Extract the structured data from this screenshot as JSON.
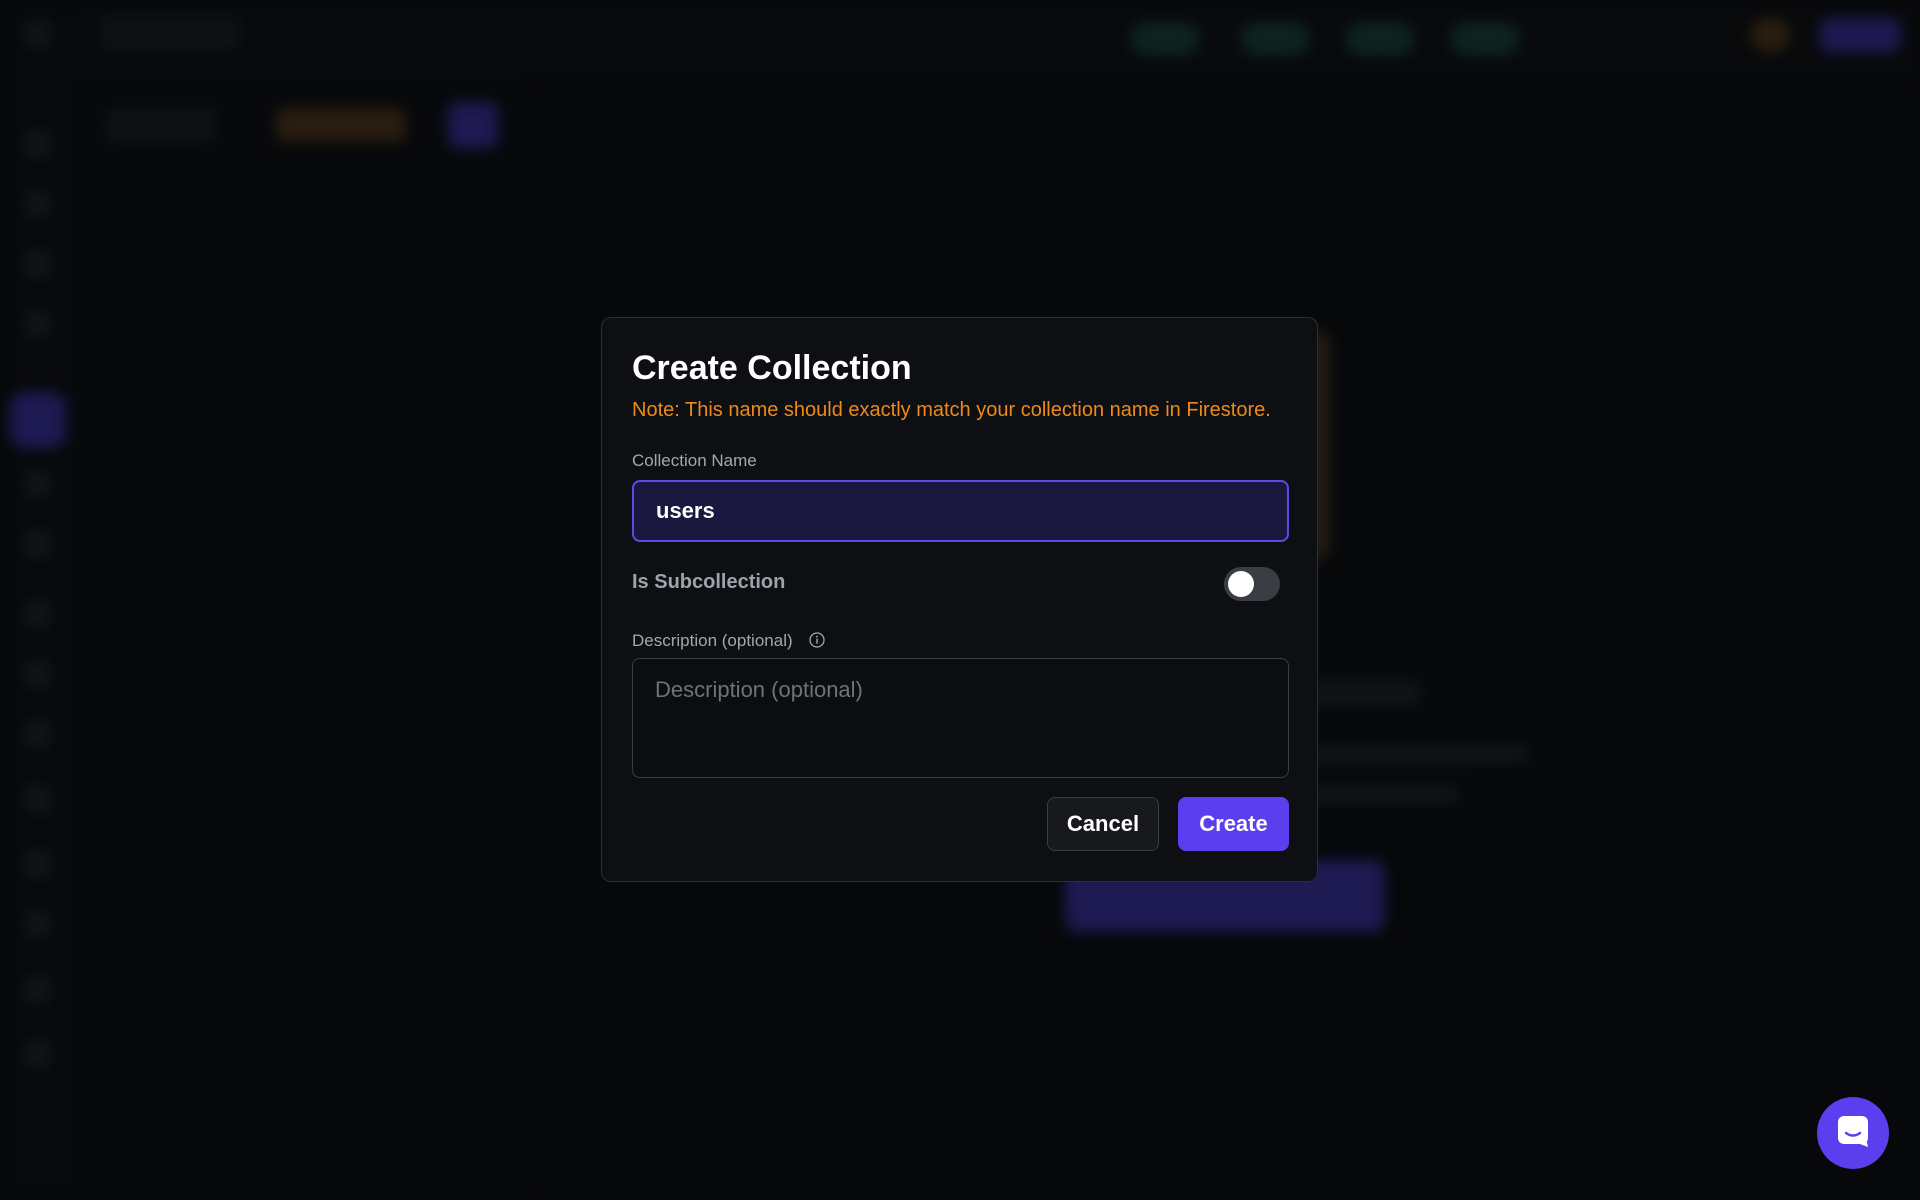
{
  "modal": {
    "title": "Create Collection",
    "note": "Note: This name should exactly match your collection name in Firestore.",
    "collection_name_label": "Collection Name",
    "collection_name_value": "users",
    "subcollection_label": "Is Subcollection",
    "subcollection_on": false,
    "description_label": "Description (optional)",
    "description_placeholder": "Description (optional)",
    "cancel_label": "Cancel",
    "create_label": "Create"
  },
  "colors": {
    "accent": "#5b3fee",
    "note": "#ee8a1a",
    "input_focus_border": "#5b4ae8",
    "modal_bg": "#0d0f12"
  },
  "icons": {
    "info": "info-icon",
    "chat": "chat-icon"
  }
}
